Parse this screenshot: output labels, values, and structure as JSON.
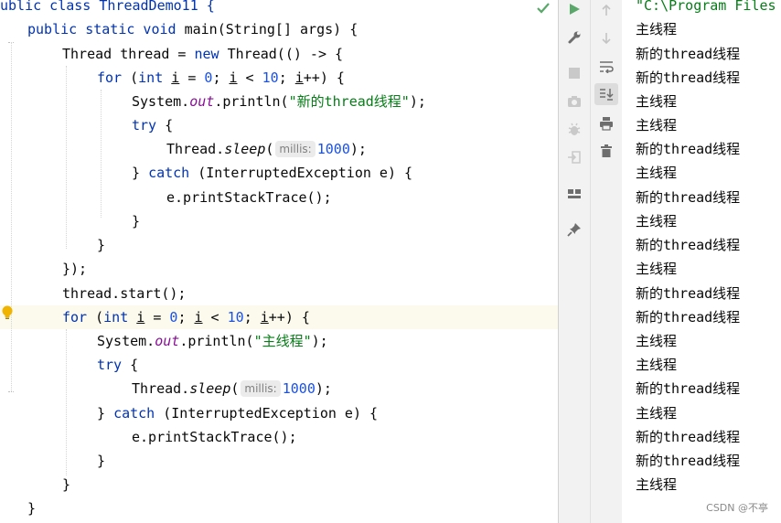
{
  "editor": {
    "code": {
      "l0_a": "ublic class ThreadDemo11 {",
      "l1_kw1": "public static void",
      "l1_rest": " main(String[] args) {",
      "l2_a": "Thread thread = ",
      "l2_kw": "new",
      "l2_b": " Thread(() -> {",
      "l3_for": "for",
      "l3_a": " (",
      "l3_int": "int",
      "l3_i1": "i",
      "l3_b": " = ",
      "l3_zero": "0",
      "l3_c": "; ",
      "l3_i2": "i",
      "l3_d": " < ",
      "l3_ten": "10",
      "l3_e": "; ",
      "l3_i3": "i",
      "l3_f": "++) {",
      "l4_a": "System.",
      "l4_out": "out",
      "l4_b": ".println(",
      "l4_str": "\"新的thread线程\"",
      "l4_c": ");",
      "l5_try": "try",
      "l5_b": " {",
      "l6_a": "Thread.",
      "l6_sleep": "sleep",
      "l6_b": "(",
      "l6_hint": "millis:",
      "l6_num": "1000",
      "l6_c": ");",
      "l7_a": "} ",
      "l7_catch": "catch",
      "l7_b": " (InterruptedException e) {",
      "l8_a": "e.printStackTrace();",
      "l9_a": "}",
      "l10_a": "}",
      "l11_a": "});",
      "l12_a": "thread.start();",
      "l13_for": "for",
      "l13_a": " (",
      "l13_int": "int",
      "l13_i1": "i",
      "l13_b": " = ",
      "l13_zero": "0",
      "l13_c": "; ",
      "l13_i2": "i",
      "l13_d": " < ",
      "l13_ten": "10",
      "l13_e": "; ",
      "l13_i3": "i",
      "l13_f": "++) {",
      "l14_a": "System.",
      "l14_out": "out",
      "l14_b": ".println(",
      "l14_str": "\"主线程\"",
      "l14_c": ");",
      "l15_try": "try",
      "l15_b": " {",
      "l16_a": "Thread.",
      "l16_sleep": "sleep",
      "l16_b": "(",
      "l16_hint": "millis:",
      "l16_num": "1000",
      "l16_c": ");",
      "l17_a": "} ",
      "l17_catch": "catch",
      "l17_b": " (InterruptedException e) {",
      "l18_a": "e.printStackTrace();",
      "l19_a": "}",
      "l20_a": "}",
      "l21_a": "}"
    }
  },
  "toolbar": {
    "icons": [
      "rerun-icon",
      "settings-wrench-icon",
      "stop-icon",
      "camera-icon",
      "debug-bug-icon",
      "exit-icon",
      "layout-icon",
      "pin-icon",
      "up-arrow-icon",
      "down-arrow-icon",
      "soft-wrap-icon",
      "scroll-to-end-icon",
      "print-icon",
      "trash-icon"
    ]
  },
  "console": {
    "command": "\"C:\\Program Files",
    "lines": [
      "主线程",
      "新的thread线程",
      "新的thread线程",
      "主线程",
      "主线程",
      "新的thread线程",
      "主线程",
      "新的thread线程",
      "主线程",
      "新的thread线程",
      "主线程",
      "新的thread线程",
      "新的thread线程",
      "主线程",
      "主线程",
      "新的thread线程",
      "主线程",
      "新的thread线程",
      "新的thread线程",
      "主线程"
    ]
  },
  "watermark": "CSDN @不亭",
  "colors": {
    "keyword": "#0033b3",
    "number": "#1750eb",
    "string": "#067d17",
    "field": "#871094",
    "run_green": "#59a869",
    "current_line": "#fcfaed"
  }
}
